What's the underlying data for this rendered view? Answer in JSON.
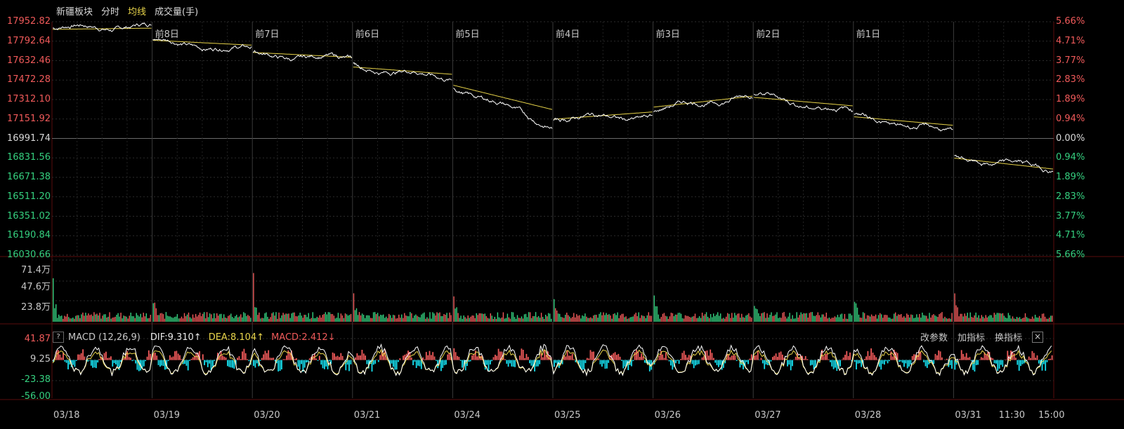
{
  "header": {
    "title": "新疆板块",
    "tabs": [
      "分时",
      "均线",
      "成交量(手)"
    ]
  },
  "price_axis": {
    "left_labels": [
      "17952.82",
      "17792.64",
      "17632.46",
      "17472.28",
      "17312.10",
      "17151.92",
      "16991.74",
      "16831.56",
      "16671.38",
      "16511.20",
      "16351.02",
      "16190.84",
      "16030.66"
    ],
    "right_labels": [
      "5.66%",
      "4.71%",
      "3.77%",
      "2.83%",
      "1.89%",
      "0.94%",
      "0.00%",
      "0.94%",
      "1.89%",
      "2.83%",
      "3.77%",
      "4.71%",
      "5.66%"
    ],
    "base_index": 6
  },
  "day_labels": [
    "前8日",
    "前7日",
    "前6日",
    "前5日",
    "前4日",
    "前3日",
    "前2日",
    "前1日"
  ],
  "volume_axis": [
    "71.4万",
    "47.6万",
    "23.8万"
  ],
  "macd": {
    "help": "?",
    "name": "MACD (12,26,9)",
    "dif": "DIF:9.310↑",
    "dea": "DEA:8.104↑",
    "macd": "MACD:2.412↓",
    "actions": [
      "改参数",
      "加指标",
      "换指标"
    ],
    "close": "×",
    "axis": [
      "41.87",
      "9.25",
      "-23.38",
      "-56.00"
    ]
  },
  "x_axis": [
    "03/18",
    "03/19",
    "03/20",
    "03/21",
    "03/24",
    "03/25",
    "03/26",
    "03/27",
    "03/28",
    "03/31",
    "11:30",
    "15:00"
  ],
  "colors": {
    "up": "#f05a5a",
    "down": "#35d07f",
    "price_line": "#ffffff",
    "avg_line": "#e8d44a",
    "macd_neg": "#16e0f0",
    "grid": "#3a0a0a"
  },
  "chart_data": {
    "type": "line",
    "title": "新疆板块",
    "xlabel": "",
    "ylabel": "",
    "ylim": [
      16030.66,
      17952.82
    ],
    "base": 16991.74,
    "x": [
      "03/18",
      "03/19",
      "03/20",
      "03/21",
      "03/24",
      "03/25",
      "03/26",
      "03/27",
      "03/28",
      "03/31"
    ],
    "series": [
      {
        "name": "分时",
        "day_open": [
          17900,
          17800,
          17690,
          17600,
          17420,
          17150,
          17220,
          17350,
          17190,
          16840
        ],
        "day_close": [
          17930,
          17730,
          17640,
          17480,
          17090,
          17170,
          17360,
          17220,
          17030,
          16730
        ]
      },
      {
        "name": "均线",
        "day_open": [
          17890,
          17800,
          17700,
          17580,
          17430,
          17150,
          17250,
          17330,
          17170,
          16830
        ],
        "day_close": [
          17900,
          17760,
          17660,
          17520,
          17230,
          17210,
          17340,
          17260,
          17100,
          16740
        ]
      }
    ],
    "volume_ylim": [
      0,
      714000
    ],
    "macd_ylim": [
      -56.0,
      41.87
    ]
  }
}
